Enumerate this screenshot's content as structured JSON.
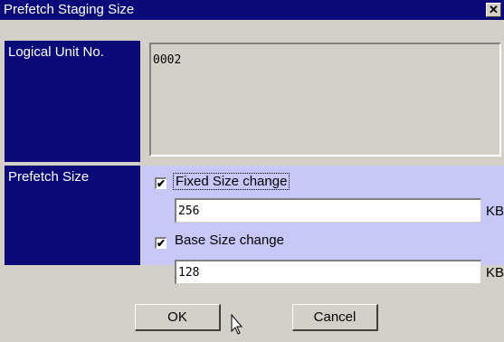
{
  "window": {
    "title": "Prefetch Staging Size",
    "close_symbol": "✕"
  },
  "logical_unit": {
    "label": "Logical Unit No.",
    "value": "0002"
  },
  "prefetch": {
    "label": "Prefetch Size",
    "fixed": {
      "label": "Fixed Size change",
      "checked": true,
      "value": "256",
      "unit": "KB"
    },
    "base": {
      "label": "Base Size change",
      "checked": true,
      "value": "128",
      "unit": "KB"
    }
  },
  "buttons": {
    "ok": "OK",
    "cancel": "Cancel"
  },
  "check_mark": "✔",
  "colors": {
    "title_bar": "#0a0a78",
    "label_cell": "#0a0a78",
    "panel": "#c8c8f8",
    "dialog_bg": "#d4d0c8"
  },
  "icons": {
    "cursor": "arrow-cursor-icon"
  }
}
